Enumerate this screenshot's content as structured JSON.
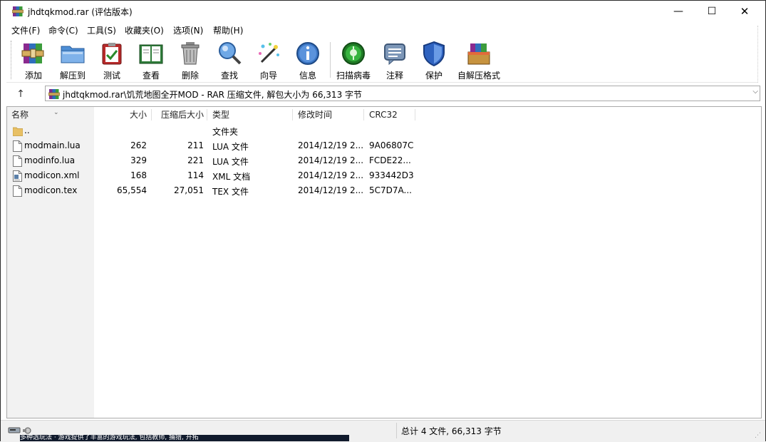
{
  "window": {
    "title": "jhdtqkmod.rar (评估版本)",
    "controls": {
      "minimize": "—",
      "maximize": "☐",
      "close": "✕"
    }
  },
  "menu": [
    "文件(F)",
    "命令(C)",
    "工具(S)",
    "收藏夹(O)",
    "选项(N)",
    "帮助(H)"
  ],
  "toolbar": [
    {
      "label": "添加",
      "icon": "add-books-icon"
    },
    {
      "label": "解压到",
      "icon": "extract-folder-icon"
    },
    {
      "label": "测试",
      "icon": "test-clipboard-icon"
    },
    {
      "label": "查看",
      "icon": "view-book-icon"
    },
    {
      "label": "删除",
      "icon": "trash-icon"
    },
    {
      "label": "查找",
      "icon": "find-magnifier-icon"
    },
    {
      "label": "向导",
      "icon": "wizard-wand-icon"
    },
    {
      "label": "信息",
      "icon": "info-icon"
    },
    {
      "label": "扫描病毒",
      "icon": "virus-scan-icon"
    },
    {
      "label": "注释",
      "icon": "comment-icon"
    },
    {
      "label": "保护",
      "icon": "shield-icon"
    },
    {
      "label": "自解压格式",
      "icon": "sfx-box-icon"
    }
  ],
  "address": {
    "up_label": "↑",
    "path": "jhdtqkmod.rar\\饥荒地图全开MOD - RAR 压缩文件, 解包大小为 66,313 字节",
    "dropdown": "⌵"
  },
  "columns": {
    "name": "名称",
    "size": "大小",
    "packed": "压缩后大小",
    "type": "类型",
    "modified": "修改时间",
    "crc": "CRC32",
    "sort_indicator": "⌄"
  },
  "files": [
    {
      "name": "..",
      "size": "",
      "packed": "",
      "type": "文件夹",
      "modified": "",
      "crc": "",
      "kind": "folder"
    },
    {
      "name": "modmain.lua",
      "size": "262",
      "packed": "211",
      "type": "LUA 文件",
      "modified": "2014/12/19 2...",
      "crc": "9A06807C",
      "kind": "file"
    },
    {
      "name": "modinfo.lua",
      "size": "329",
      "packed": "221",
      "type": "LUA 文件",
      "modified": "2014/12/19 2...",
      "crc": "FCDE22...",
      "kind": "file"
    },
    {
      "name": "modicon.xml",
      "size": "168",
      "packed": "114",
      "type": "XML 文档",
      "modified": "2014/12/19 2...",
      "crc": "933442D3",
      "kind": "xml"
    },
    {
      "name": "modicon.tex",
      "size": "65,554",
      "packed": "27,051",
      "type": "TEX 文件",
      "modified": "2014/12/19 2...",
      "crc": "5C7D7A...",
      "kind": "file"
    }
  ],
  "status": {
    "summary": "总计 4 文件, 66,313 字节"
  },
  "taskbar_peek": "多种选玩法 · 游戏提供了丰富的游戏玩法, 包括教师, 捕猎, 开拓"
}
